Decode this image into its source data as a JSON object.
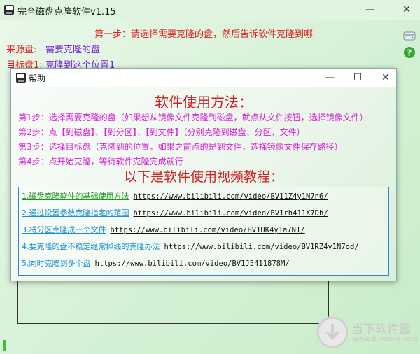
{
  "main_window": {
    "title": "完全磁盘克隆软件v1.15",
    "controls": {
      "minimize": "—",
      "close": "✕"
    },
    "step_text": "第一步：请选择需要克隆的盘，然后告诉软件克隆到哪",
    "source_label": "来源盘:",
    "source_value": "需要克隆的盘",
    "target_label": "目标盘1:",
    "target_value": "克隆到这个位置1"
  },
  "help_dialog": {
    "title": "帮助",
    "controls": {
      "minimize": "—",
      "maximize": "☐",
      "close": "✕"
    },
    "heading": "软件使用方法：",
    "steps": [
      "第1步：选择需要克隆的盘（如果想从镜像文件克隆到磁盘，就点从文件按钮，选择镜像文件）",
      "第2步：点【到磁盘】、【到分区】、【到文件】（分别克隆到磁盘、分区、文件）",
      "第3步：选择目标盘（克隆到的位置，如果之前点的是到文件，选择镜像文件保存路径）",
      "第4步：点开始克隆，等待软件克隆完成就行"
    ],
    "video_heading": "以下是软件使用视频教程：",
    "videos": [
      {
        "label": "1.磁盘克隆软件的基础使用方法",
        "url": "https://www.bilibili.com/video/BV11Z4y1N7n6/"
      },
      {
        "label": "2.通过设置参数克隆指定的范围",
        "url": "https://www.bilibili.com/video/BV1rh411X7Dh/"
      },
      {
        "label": "3.将分区克隆成一个文件",
        "url": "https://www.bilibili.com/video/BV1UK4y1a7N1/"
      },
      {
        "label": "4.要克隆的盘不稳定经常掉线的克隆办法",
        "url": "https://www.bilibili.com/video/BV1RZ4y1N7od/"
      },
      {
        "label": "5.同时克隆到多个盘",
        "url": "https://www.bilibili.com/video/BV1J5411878M/"
      }
    ]
  },
  "watermark": {
    "main": "当下软件园",
    "url": "www.downxia.com"
  },
  "icons": {
    "app": "disk-app-icon",
    "side_top": "disk-list-icon",
    "side_help": "help-question-icon"
  },
  "colors": {
    "accent_red": "#e02020",
    "accent_purple": "#7a1fe0",
    "step_magenta": "#d81fd8",
    "link_blue": "#1a8fd0",
    "link_green": "#1a9a1a"
  }
}
